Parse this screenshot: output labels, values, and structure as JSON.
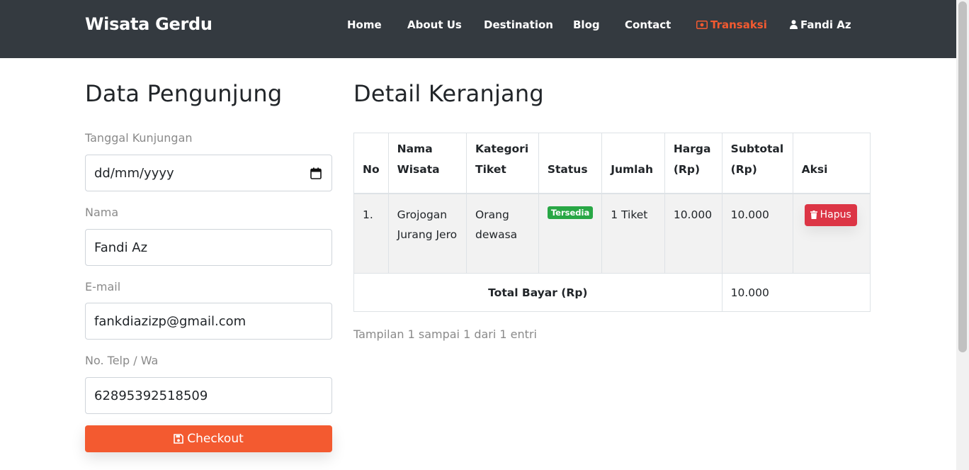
{
  "navbar": {
    "brand": "Wisata Gerdu",
    "items": [
      {
        "label": "Home"
      },
      {
        "label": "About Us"
      },
      {
        "label": "Destination"
      },
      {
        "label": "Blog"
      },
      {
        "label": "Contact"
      },
      {
        "label": "Transaksi",
        "icon": "money-icon",
        "active": true
      },
      {
        "label": "Fandi Az",
        "icon": "user-icon"
      }
    ],
    "active_color": "#f35a30"
  },
  "visitor": {
    "title": "Data Pengunjung",
    "date_label": "Tanggal Kunjungan",
    "date_value": "dd/mm/yyyy",
    "name_label": "Nama",
    "name_value": "Fandi Az",
    "email_label": "E-mail",
    "email_value": "fankdiazizp@gmail.com",
    "phone_label": "No. Telp / Wa",
    "phone_value": "62895392518509",
    "checkout_label": "Checkout"
  },
  "cart": {
    "title": "Detail Keranjang",
    "headers": {
      "no": "No",
      "nama_line1": "Nama",
      "nama_line2": "Wisata",
      "kategori_line1": "Kategori",
      "kategori_line2": "Tiket",
      "status": "Status",
      "jumlah": "Jumlah",
      "harga_line1": "Harga",
      "harga_line2": "(Rp)",
      "subtotal_line1": "Subtotal",
      "subtotal_line2": "(Rp)",
      "aksi": "Aksi"
    },
    "rows": [
      {
        "no": "1.",
        "nama": "Grojogan Jurang Jero",
        "kategori": "Orang dewasa",
        "status": "Tersedia",
        "jumlah": "1 Tiket",
        "harga": "10.000",
        "subtotal": "10.000",
        "action": "Hapus"
      }
    ],
    "total_label": "Total Bayar (Rp)",
    "total_value": "10.000",
    "info": "Tampilan 1 sampai 1 dari 1 entri",
    "badge_color": "#28a745",
    "delete_color": "#dc3545"
  }
}
